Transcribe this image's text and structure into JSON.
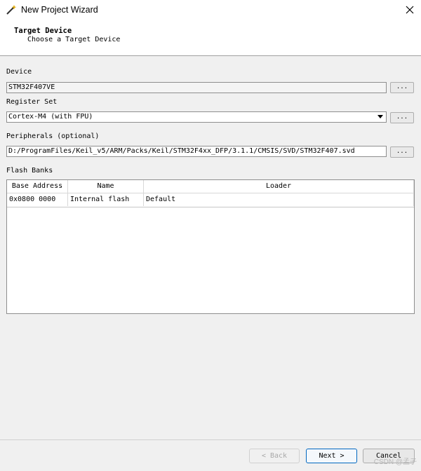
{
  "window": {
    "title": "New Project Wizard"
  },
  "header": {
    "title": "Target Device",
    "subtitle": "Choose a Target Device"
  },
  "device": {
    "label": "Device",
    "value": "STM32F407VE",
    "browse_label": "..."
  },
  "register_set": {
    "label": "Register Set",
    "value": "Cortex-M4 (with FPU)",
    "browse_label": "..."
  },
  "peripherals": {
    "label": "Peripherals (optional)",
    "value": "D:/ProgramFiles/Keil_v5/ARM/Packs/Keil/STM32F4xx_DFP/3.1.1/CMSIS/SVD/STM32F407.svd",
    "browse_label": "..."
  },
  "flash_banks": {
    "label": "Flash Banks",
    "columns": [
      "Base Address",
      "Name",
      "Loader"
    ],
    "rows": [
      [
        "0x0800 0000",
        "Internal flash",
        "Default"
      ]
    ]
  },
  "buttons": {
    "back": "< Back",
    "next": "Next >",
    "cancel": "Cancel"
  },
  "watermark": "CSDN @孟子"
}
